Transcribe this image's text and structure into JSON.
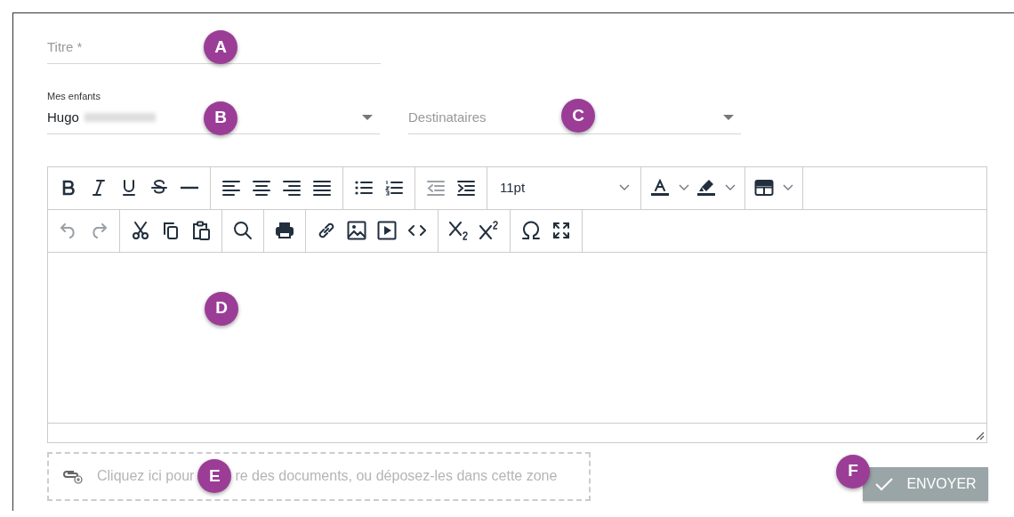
{
  "title_field": {
    "placeholder": "Titre *",
    "marker": "A"
  },
  "children_select": {
    "label": "Mes enfants",
    "value": "Hugo",
    "marker": "B"
  },
  "recipients_select": {
    "placeholder": "Destinataires",
    "marker": "C"
  },
  "editor": {
    "marker": "D",
    "toolbar": [
      [
        [
          {
            "kind": "bold",
            "disabled": false
          },
          {
            "kind": "italic",
            "disabled": false
          },
          {
            "kind": "underline",
            "disabled": false
          },
          {
            "kind": "strike",
            "disabled": false
          },
          {
            "kind": "hr",
            "disabled": false
          }
        ],
        [
          {
            "kind": "align-left",
            "disabled": false
          },
          {
            "kind": "align-center",
            "disabled": false
          },
          {
            "kind": "align-right",
            "disabled": false
          },
          {
            "kind": "justify",
            "disabled": false
          }
        ],
        [
          {
            "kind": "bullets",
            "disabled": false
          },
          {
            "kind": "numbers",
            "disabled": false
          }
        ],
        [
          {
            "kind": "outdent",
            "disabled": true
          },
          {
            "kind": "indent",
            "disabled": false
          }
        ],
        [
          {
            "kind": "select",
            "value": "11pt"
          }
        ],
        [
          {
            "kind": "text-color"
          },
          {
            "kind": "highlight"
          }
        ],
        [
          {
            "kind": "table"
          }
        ]
      ],
      [
        [
          {
            "kind": "undo",
            "disabled": true
          },
          {
            "kind": "redo",
            "disabled": true
          }
        ],
        [
          {
            "kind": "cut",
            "disabled": false
          },
          {
            "kind": "copy",
            "disabled": false
          },
          {
            "kind": "paste",
            "disabled": false
          }
        ],
        [
          {
            "kind": "search",
            "disabled": false
          }
        ],
        [
          {
            "kind": "print",
            "disabled": false
          }
        ],
        [
          {
            "kind": "link",
            "disabled": false
          },
          {
            "kind": "image",
            "disabled": false
          },
          {
            "kind": "media",
            "disabled": false
          },
          {
            "kind": "code",
            "disabled": false
          }
        ],
        [
          {
            "kind": "subscript",
            "disabled": false
          },
          {
            "kind": "superscript",
            "disabled": false
          }
        ],
        [
          {
            "kind": "charmap",
            "disabled": false
          },
          {
            "kind": "fullscreen",
            "disabled": false
          }
        ]
      ]
    ]
  },
  "dropzone": {
    "text_before": "Cliquez ici pour",
    "text_after": "re des documents, ou déposez-les dans cette zone",
    "marker": "E"
  },
  "send_button": {
    "label": "ENVOYER",
    "disabled": true,
    "marker": "F"
  }
}
